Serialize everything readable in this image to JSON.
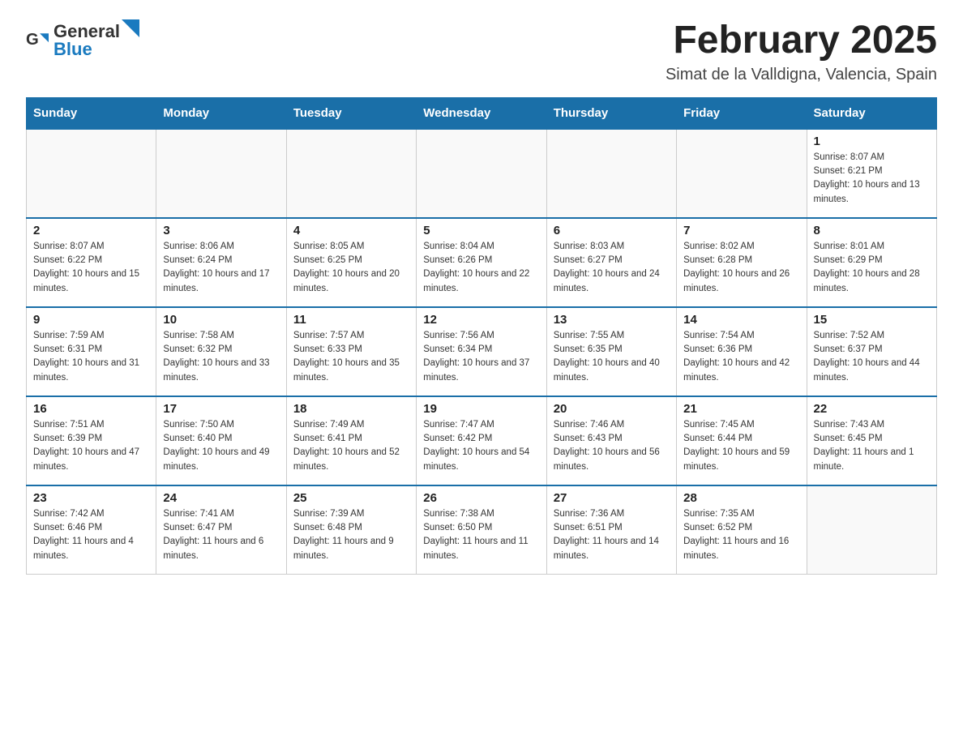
{
  "header": {
    "logo_general": "General",
    "logo_blue": "Blue",
    "month_title": "February 2025",
    "location": "Simat de la Valldigna, Valencia, Spain"
  },
  "weekdays": [
    "Sunday",
    "Monday",
    "Tuesday",
    "Wednesday",
    "Thursday",
    "Friday",
    "Saturday"
  ],
  "weeks": [
    [
      {
        "day": "",
        "info": ""
      },
      {
        "day": "",
        "info": ""
      },
      {
        "day": "",
        "info": ""
      },
      {
        "day": "",
        "info": ""
      },
      {
        "day": "",
        "info": ""
      },
      {
        "day": "",
        "info": ""
      },
      {
        "day": "1",
        "info": "Sunrise: 8:07 AM\nSunset: 6:21 PM\nDaylight: 10 hours and 13 minutes."
      }
    ],
    [
      {
        "day": "2",
        "info": "Sunrise: 8:07 AM\nSunset: 6:22 PM\nDaylight: 10 hours and 15 minutes."
      },
      {
        "day": "3",
        "info": "Sunrise: 8:06 AM\nSunset: 6:24 PM\nDaylight: 10 hours and 17 minutes."
      },
      {
        "day": "4",
        "info": "Sunrise: 8:05 AM\nSunset: 6:25 PM\nDaylight: 10 hours and 20 minutes."
      },
      {
        "day": "5",
        "info": "Sunrise: 8:04 AM\nSunset: 6:26 PM\nDaylight: 10 hours and 22 minutes."
      },
      {
        "day": "6",
        "info": "Sunrise: 8:03 AM\nSunset: 6:27 PM\nDaylight: 10 hours and 24 minutes."
      },
      {
        "day": "7",
        "info": "Sunrise: 8:02 AM\nSunset: 6:28 PM\nDaylight: 10 hours and 26 minutes."
      },
      {
        "day": "8",
        "info": "Sunrise: 8:01 AM\nSunset: 6:29 PM\nDaylight: 10 hours and 28 minutes."
      }
    ],
    [
      {
        "day": "9",
        "info": "Sunrise: 7:59 AM\nSunset: 6:31 PM\nDaylight: 10 hours and 31 minutes."
      },
      {
        "day": "10",
        "info": "Sunrise: 7:58 AM\nSunset: 6:32 PM\nDaylight: 10 hours and 33 minutes."
      },
      {
        "day": "11",
        "info": "Sunrise: 7:57 AM\nSunset: 6:33 PM\nDaylight: 10 hours and 35 minutes."
      },
      {
        "day": "12",
        "info": "Sunrise: 7:56 AM\nSunset: 6:34 PM\nDaylight: 10 hours and 37 minutes."
      },
      {
        "day": "13",
        "info": "Sunrise: 7:55 AM\nSunset: 6:35 PM\nDaylight: 10 hours and 40 minutes."
      },
      {
        "day": "14",
        "info": "Sunrise: 7:54 AM\nSunset: 6:36 PM\nDaylight: 10 hours and 42 minutes."
      },
      {
        "day": "15",
        "info": "Sunrise: 7:52 AM\nSunset: 6:37 PM\nDaylight: 10 hours and 44 minutes."
      }
    ],
    [
      {
        "day": "16",
        "info": "Sunrise: 7:51 AM\nSunset: 6:39 PM\nDaylight: 10 hours and 47 minutes."
      },
      {
        "day": "17",
        "info": "Sunrise: 7:50 AM\nSunset: 6:40 PM\nDaylight: 10 hours and 49 minutes."
      },
      {
        "day": "18",
        "info": "Sunrise: 7:49 AM\nSunset: 6:41 PM\nDaylight: 10 hours and 52 minutes."
      },
      {
        "day": "19",
        "info": "Sunrise: 7:47 AM\nSunset: 6:42 PM\nDaylight: 10 hours and 54 minutes."
      },
      {
        "day": "20",
        "info": "Sunrise: 7:46 AM\nSunset: 6:43 PM\nDaylight: 10 hours and 56 minutes."
      },
      {
        "day": "21",
        "info": "Sunrise: 7:45 AM\nSunset: 6:44 PM\nDaylight: 10 hours and 59 minutes."
      },
      {
        "day": "22",
        "info": "Sunrise: 7:43 AM\nSunset: 6:45 PM\nDaylight: 11 hours and 1 minute."
      }
    ],
    [
      {
        "day": "23",
        "info": "Sunrise: 7:42 AM\nSunset: 6:46 PM\nDaylight: 11 hours and 4 minutes."
      },
      {
        "day": "24",
        "info": "Sunrise: 7:41 AM\nSunset: 6:47 PM\nDaylight: 11 hours and 6 minutes."
      },
      {
        "day": "25",
        "info": "Sunrise: 7:39 AM\nSunset: 6:48 PM\nDaylight: 11 hours and 9 minutes."
      },
      {
        "day": "26",
        "info": "Sunrise: 7:38 AM\nSunset: 6:50 PM\nDaylight: 11 hours and 11 minutes."
      },
      {
        "day": "27",
        "info": "Sunrise: 7:36 AM\nSunset: 6:51 PM\nDaylight: 11 hours and 14 minutes."
      },
      {
        "day": "28",
        "info": "Sunrise: 7:35 AM\nSunset: 6:52 PM\nDaylight: 11 hours and 16 minutes."
      },
      {
        "day": "",
        "info": ""
      }
    ]
  ]
}
